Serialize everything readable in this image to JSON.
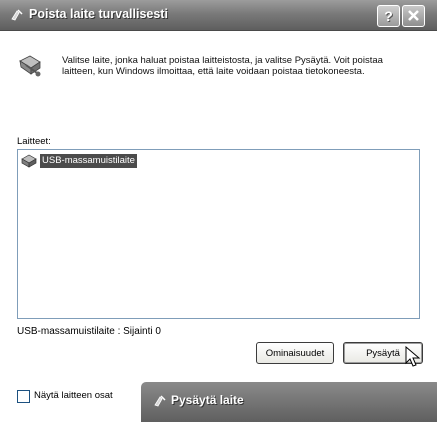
{
  "window": {
    "title": "Poista laite turvallisesti",
    "help_glyph": "?",
    "title_icon": "safely-remove-icon"
  },
  "description": "Valitse laite, jonka haluat poistaa laitteistosta, ja valitse Pysäytä. Voit poistaa laitteen, kun Windows ilmoittaa, että laite voidaan poistaa tietokoneesta.",
  "devices": {
    "label": "Laitteet:",
    "items": [
      {
        "label": "USB-massamuistilaite",
        "icon": "usb-device-icon",
        "selected": true
      }
    ]
  },
  "status": "USB-massamuistilaite : Sijainti 0",
  "buttons": {
    "properties": "Ominaisuudet",
    "stop": "Pysäytä"
  },
  "checkbox": {
    "label": "Näytä laitteen osat",
    "checked": false
  },
  "popup": {
    "title": "Pysäytä laite"
  }
}
